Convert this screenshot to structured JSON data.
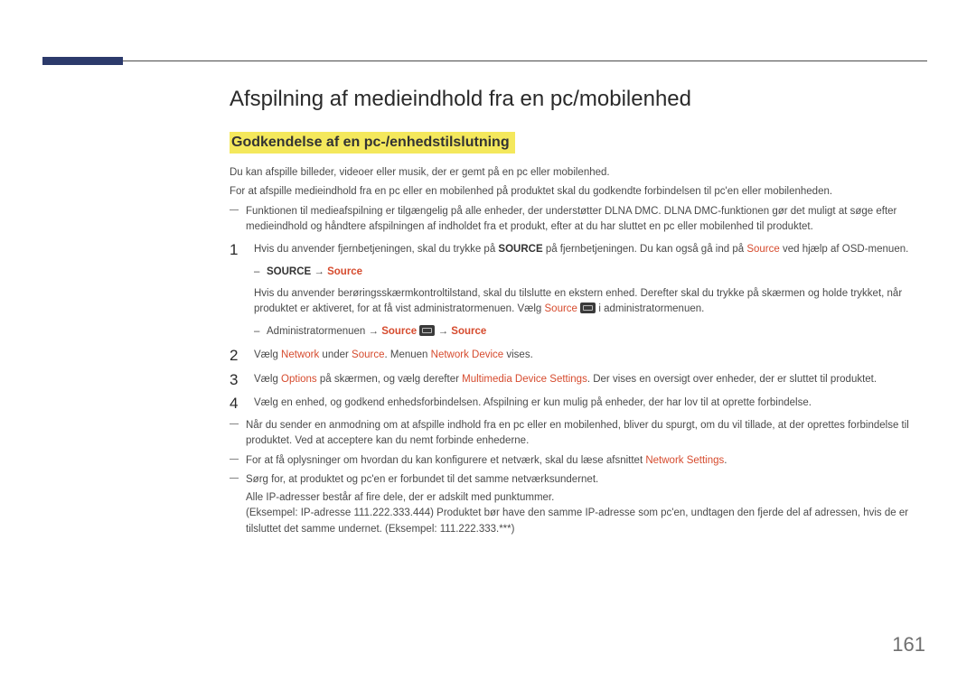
{
  "title": "Afspilning af medieindhold fra en pc/mobilenhed",
  "subhead": "Godkendelse af en pc-/enhedstilslutning",
  "para1": "Du kan afspille billeder, videoer eller musik, der er gemt på en pc eller mobilenhed.",
  "para2": "For at afspille medieindhold fra en pc eller en mobilenhed på produktet skal du godkendte forbindelsen til pc'en eller mobilenheden.",
  "note_top": "Funktionen til medieafspilning er tilgængelig på alle enheder, der understøtter DLNA DMC. DLNA DMC-funktionen gør det muligt at søge efter medieindhold og håndtere afspilningen af indholdet fra et produkt, efter at du har sluttet en pc eller mobilenhed til produktet.",
  "step1": {
    "a": "Hvis du anvender fjernbetjeningen, skal du trykke på ",
    "source_bold": "SOURCE",
    "b": " på fjernbetjeningen. Du kan også gå ind på ",
    "source_red": "Source",
    "c": " ved hjælp af OSD-menuen.",
    "bullet1": {
      "source_bold": "SOURCE",
      "arrow": " → ",
      "source_red": "Source"
    },
    "d": "Hvis du anvender berøringsskærmkontroltilstand, skal du tilslutte en ekstern enhed. Derefter skal du trykke på skærmen og holde trykket, når produktet er aktiveret, for at få vist administratormenuen. Vælg ",
    "e": " i administratormenuen.",
    "bullet2": {
      "a": "Administratormenuen → ",
      "s1": "Source",
      "arrow": " → ",
      "s2": "Source"
    }
  },
  "step2": {
    "a": "Vælg ",
    "network": "Network",
    "b": " under ",
    "source": "Source",
    "c": ". Menuen ",
    "nd": "Network Device",
    "d": " vises."
  },
  "step3": {
    "a": "Vælg ",
    "options": "Options",
    "b": " på skærmen, og vælg derefter ",
    "mds": "Multimedia Device Settings",
    "c": ". Der vises en oversigt over enheder, der er sluttet til produktet."
  },
  "step4": "Vælg en enhed, og godkend enhedsforbindelsen. Afspilning er kun mulig på enheder, der har lov til at oprette forbindelse.",
  "note_b1": "Når du sender en anmodning om at afspille indhold fra en pc eller en mobilenhed, bliver du spurgt, om du vil tillade, at der oprettes forbindelse til produktet. Ved at acceptere kan du nemt forbinde enhederne.",
  "note_b2_a": "For at få oplysninger om hvordan du kan konfigurere et netværk, skal du læse afsnittet ",
  "note_b2_ns": "Network Settings",
  "note_b2_b": ".",
  "note_b3": "Sørg for, at produktet og pc'en er forbundet til det samme netværksundernet.",
  "ip1": "Alle IP-adresser består af fire dele, der er adskilt med punktummer.",
  "ip2": "(Eksempel: IP-adresse 111.222.333.444) Produktet bør have den samme IP-adresse som pc'en, undtagen den fjerde del af adressen, hvis de er tilsluttet det samme undernet. (Eksempel: 111.222.333.***)",
  "page": "161"
}
